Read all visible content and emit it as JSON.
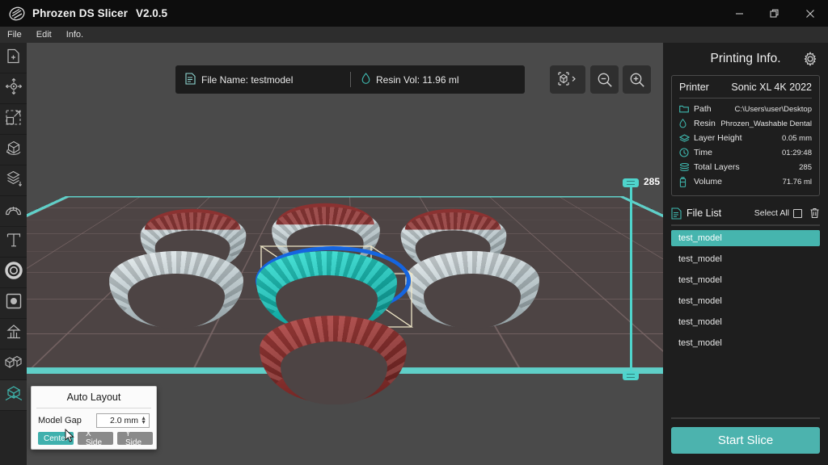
{
  "window": {
    "app_title": "Phrozen DS Slicer",
    "version": "V2.0.5",
    "logo_icon": "phrozen-logo-icon",
    "minimize_icon": "minimize-icon",
    "maximize_icon": "maximize-icon",
    "close_icon": "close-icon"
  },
  "menubar": {
    "items": [
      {
        "label": "File"
      },
      {
        "label": "Edit"
      },
      {
        "label": "Info."
      }
    ]
  },
  "left_toolbar": {
    "items": [
      {
        "name": "add-file-tool",
        "icon": "add-file-icon",
        "active": false
      },
      {
        "name": "move-tool",
        "icon": "move-arrows-icon",
        "active": false
      },
      {
        "name": "scale-tool",
        "icon": "scale-icon",
        "active": false
      },
      {
        "name": "rotate-tool",
        "icon": "rotate-cube-icon",
        "active": false
      },
      {
        "name": "layer-tool",
        "icon": "stacked-layers-icon",
        "active": false
      },
      {
        "name": "arch-tool",
        "icon": "dental-arch-icon",
        "active": false
      },
      {
        "name": "text-tool",
        "icon": "text-icon",
        "active": false
      },
      {
        "name": "hollow-tool",
        "icon": "hollow-ring-icon",
        "active": false
      },
      {
        "name": "punch-hole-tool",
        "icon": "punch-hole-icon",
        "active": false
      },
      {
        "name": "support-tool",
        "icon": "support-icon",
        "active": false
      },
      {
        "name": "copy-tool",
        "icon": "duplicate-cubes-icon",
        "active": false
      },
      {
        "name": "auto-layout-tool",
        "icon": "auto-layout-icon",
        "active": true
      }
    ]
  },
  "viewport": {
    "info_bar": {
      "file_icon": "document-icon",
      "file_name_label": "File Name: testmodel",
      "resin_icon": "droplet-icon",
      "resin_vol_label": "Resin Vol:  11.96 ml"
    },
    "buttons": [
      {
        "name": "view-cube-button",
        "icon": "view-cube-icon"
      },
      {
        "name": "zoom-out-button",
        "icon": "zoom-out-icon"
      },
      {
        "name": "zoom-in-button",
        "icon": "zoom-in-icon"
      }
    ],
    "layer_slider": {
      "top_value": "285",
      "min_value": "1"
    },
    "scene": {
      "build_plate_color": "#5fcfc8",
      "grid_color": "#7d6969",
      "models": [
        {
          "name": "arch-back-left",
          "color": "grey",
          "state": "normal"
        },
        {
          "name": "arch-back-center",
          "color": "grey",
          "state": "normal"
        },
        {
          "name": "arch-back-right",
          "color": "grey",
          "state": "normal"
        },
        {
          "name": "arch-mid-left",
          "color": "grey",
          "state": "normal"
        },
        {
          "name": "arch-selected",
          "color": "teal",
          "state": "selected"
        },
        {
          "name": "arch-mid-right",
          "color": "grey",
          "state": "normal"
        },
        {
          "name": "arch-front",
          "color": "red",
          "state": "out-of-bounds"
        }
      ],
      "selection_highlight_color": "#1565e0",
      "bounding_box_color": "#f0e8c8"
    }
  },
  "auto_layout": {
    "title": "Auto Layout",
    "model_gap_label": "Model Gap",
    "model_gap_value": "2.0 mm",
    "buttons": [
      {
        "label": "Center",
        "primary": true
      },
      {
        "label": "X Side",
        "primary": false
      },
      {
        "label": "Y Side",
        "primary": false
      }
    ]
  },
  "right_panel": {
    "title": "Printing Info.",
    "gear_icon": "gear-icon",
    "printer": {
      "label": "Printer",
      "value": "Sonic XL 4K 2022"
    },
    "info_rows": [
      {
        "icon": "folder-icon",
        "label": "Path",
        "value": "C:\\Users\\user\\Desktop"
      },
      {
        "icon": "droplet-icon",
        "label": "Resin",
        "value": "Phrozen_Washable Dental"
      },
      {
        "icon": "layer-icon",
        "label": "Layer Height",
        "value": "0.05 mm"
      },
      {
        "icon": "clock-icon",
        "label": "Time",
        "value": "01:29:48"
      },
      {
        "icon": "stack-icon",
        "label": "Total Layers",
        "value": "285"
      },
      {
        "icon": "bottle-icon",
        "label": "Volume",
        "value": "71.76 ml"
      }
    ],
    "file_list": {
      "icon": "file-list-icon",
      "title": "File List",
      "select_all_label": "Select All",
      "select_all_checked": false,
      "trash_icon": "trash-icon",
      "items": [
        {
          "label": "test_model",
          "selected": true
        },
        {
          "label": "test_model",
          "selected": false
        },
        {
          "label": "test_model",
          "selected": false
        },
        {
          "label": "test_model",
          "selected": false
        },
        {
          "label": "test_model",
          "selected": false
        },
        {
          "label": "test_model",
          "selected": false
        }
      ]
    },
    "start_slice_label": "Start Slice"
  },
  "colors": {
    "accent_teal": "#4cb3ae",
    "panel_bg": "#1e1e1e",
    "viewport_bg": "#4a4a4a",
    "selection_blue": "#1565e0"
  }
}
